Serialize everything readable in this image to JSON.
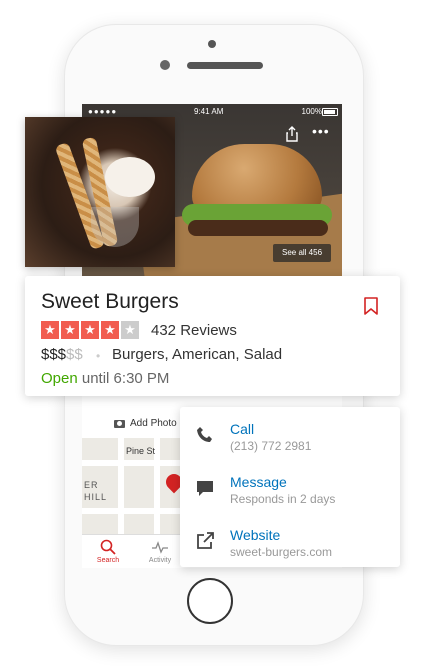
{
  "status_bar": {
    "signal": "●●●●●",
    "time": "9:41 AM",
    "battery": "100%"
  },
  "hero": {
    "see_all": "See all 456"
  },
  "business": {
    "name": "Sweet Burgers",
    "rating": 4,
    "max_rating": 5,
    "reviews": "432 Reviews",
    "price_active": "$$$",
    "price_dim": "$$",
    "separator": "•",
    "categories": "Burgers, American, Salad",
    "open_label": "Open",
    "hours": "until 6:30 PM"
  },
  "add_photo": "Add Photo",
  "map": {
    "street1": "Pine St",
    "street2": "ER",
    "street3": "HILL"
  },
  "tabs": [
    {
      "label": "Search",
      "icon": "search-icon"
    },
    {
      "label": "Activity",
      "icon": "activity-icon"
    }
  ],
  "actions": [
    {
      "title": "Call",
      "subtitle": "(213) 772 2981",
      "icon": "phone-icon"
    },
    {
      "title": "Message",
      "subtitle": "Responds in 2 days",
      "icon": "message-icon"
    },
    {
      "title": "Website",
      "subtitle": "sweet-burgers.com",
      "icon": "external-link-icon"
    }
  ],
  "colors": {
    "accent": "#d32323",
    "star": "#f15c4f",
    "link": "#0073bb",
    "open": "#41a700"
  }
}
